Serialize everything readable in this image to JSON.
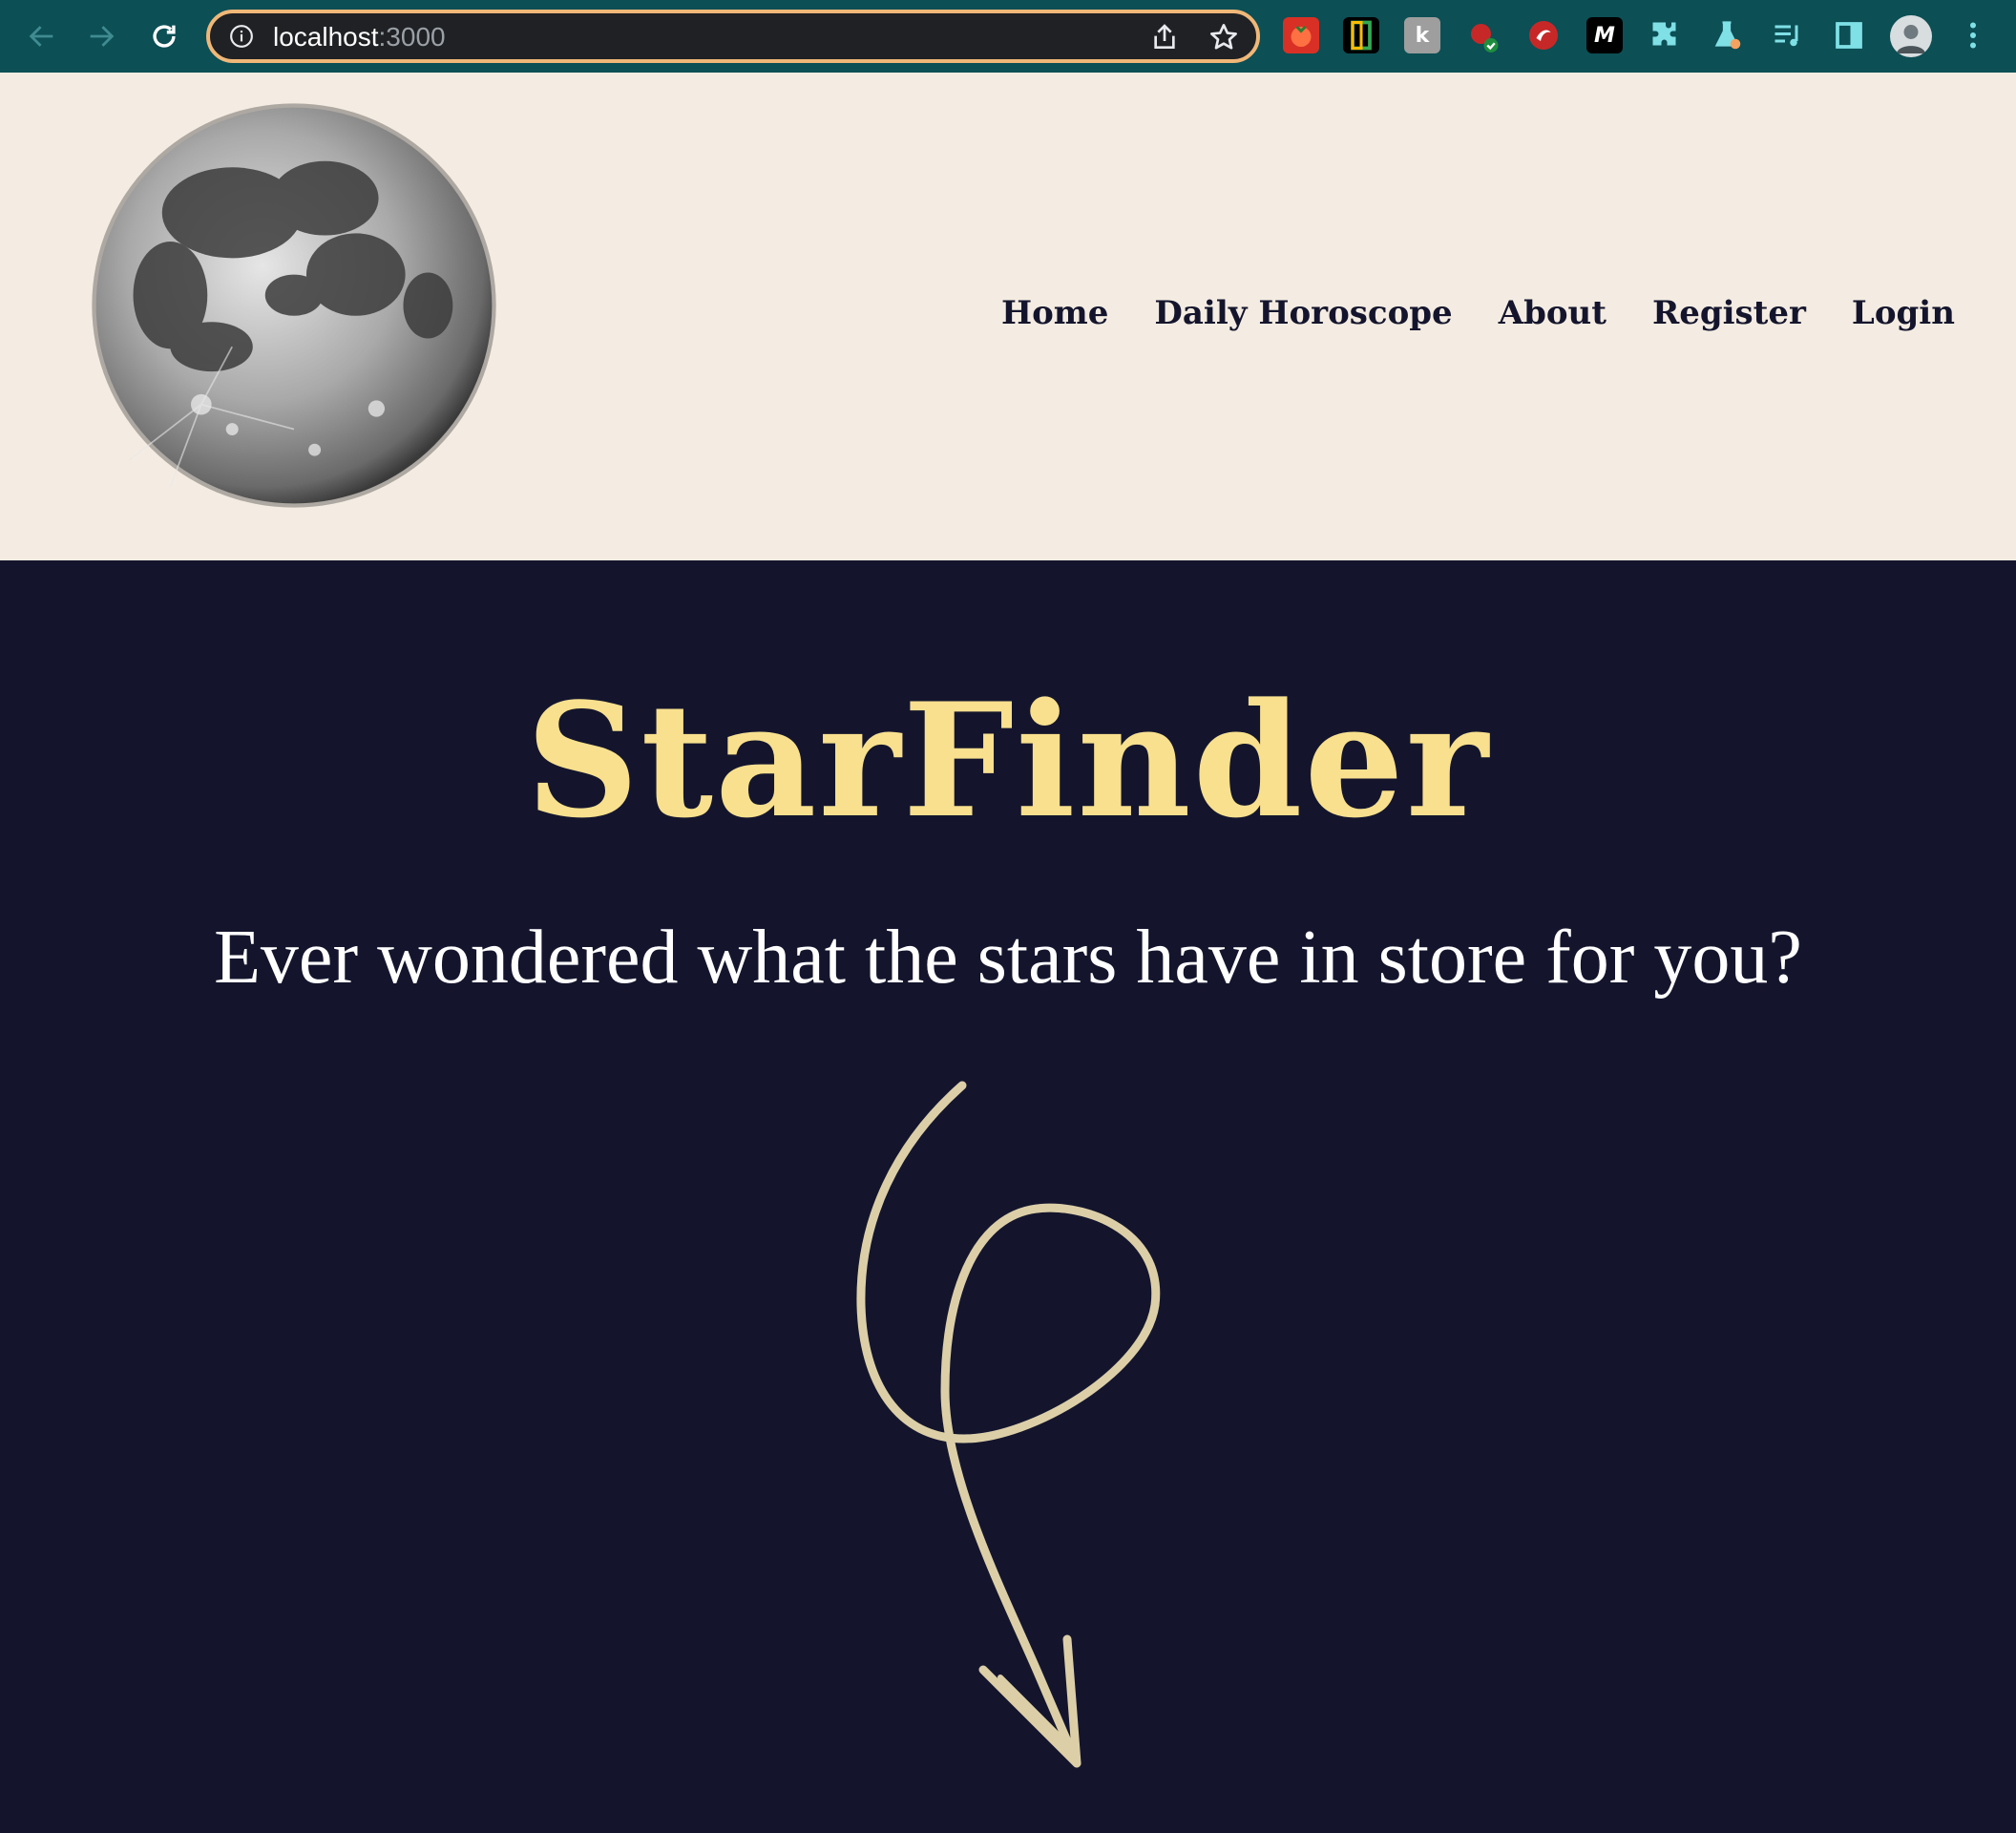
{
  "browser": {
    "url_host": "localhost",
    "url_port": ":3000",
    "extensions": [
      {
        "icon": "tomato-extension-icon",
        "color": "#d93025"
      },
      {
        "icon": "page-extension-icon",
        "color": "#000000"
      },
      {
        "icon": "k-extension-icon",
        "color": "#9e9e9e"
      },
      {
        "icon": "raspberry-extension-icon",
        "color": "#c62828"
      },
      {
        "icon": "red-circle-extension-icon",
        "color": "#c62828"
      },
      {
        "icon": "m-extension-icon",
        "color": "#000000"
      },
      {
        "icon": "puzzle-extensions-icon",
        "color": "#7fe0e6"
      },
      {
        "icon": "flask-extension-icon",
        "color": "#7fe0e6"
      },
      {
        "icon": "media-controls-icon",
        "color": "#7fe0e6"
      },
      {
        "icon": "side-panel-icon",
        "color": "#7fe0e6"
      }
    ],
    "ext_k_label": "k",
    "ext_m_label": "M"
  },
  "site": {
    "logo": "moon-logo",
    "nav": [
      {
        "label": "Home"
      },
      {
        "label": "Daily Horoscope"
      },
      {
        "label": "About"
      },
      {
        "label": "Register"
      },
      {
        "label": "Login"
      }
    ],
    "hero": {
      "title": "StarFinder",
      "subtitle": "Ever wondered what the stars have in store for you?",
      "arrow": "curly-arrow-down"
    }
  },
  "colors": {
    "chrome_bg": "#0c4f55",
    "header_bg": "#f4ece2",
    "hero_bg": "#14152d",
    "title": "#f8e08e",
    "arrow": "#dccfa8",
    "omnibox_border": "#f0b778"
  }
}
